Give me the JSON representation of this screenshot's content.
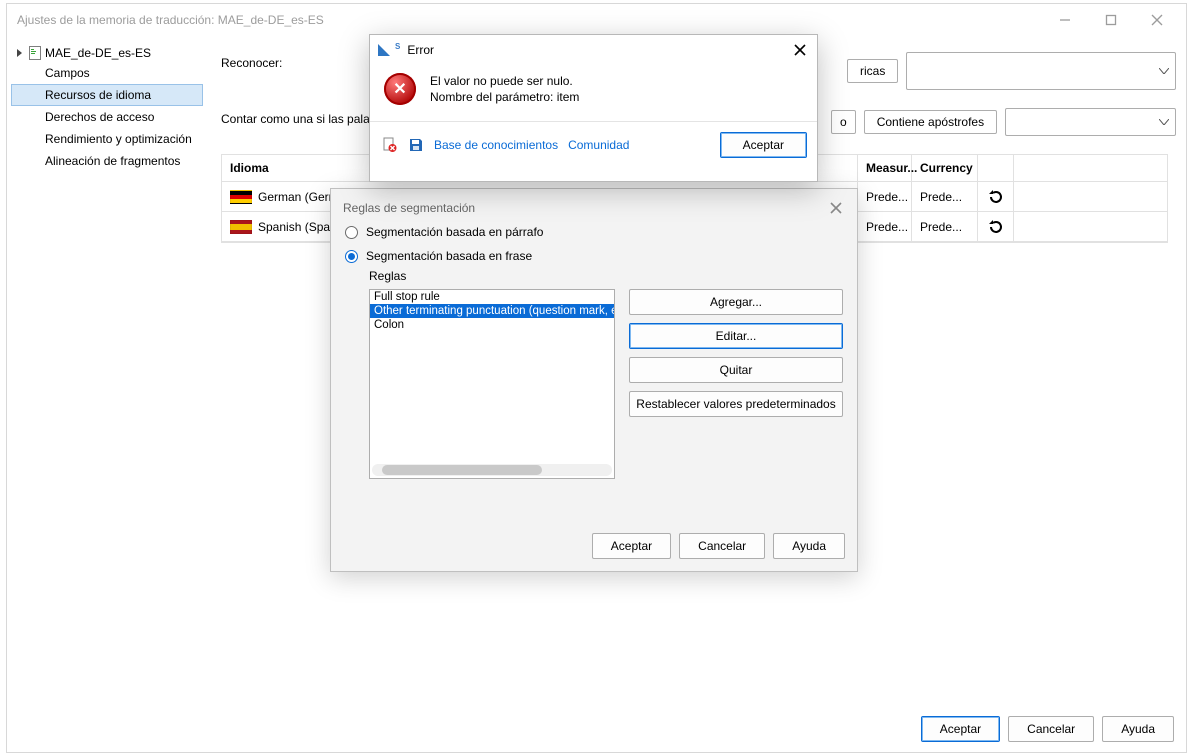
{
  "window": {
    "title": "Ajustes de la memoria de traducción: MAE_de-DE_es-ES"
  },
  "sidebar": {
    "root": "MAE_de-DE_es-ES",
    "items": [
      "Campos",
      "Recursos de idioma",
      "Derechos de acceso",
      "Rendimiento y optimización",
      "Alineación de fragmentos"
    ],
    "selected_index": 1
  },
  "main": {
    "recognize_label": "Reconocer:",
    "recognize_chip_partial": "ricas",
    "count_label": "Contar como una si las palab",
    "count_chip_partial": "o",
    "count_chip2": "Contiene apóstrofes",
    "table": {
      "columns": [
        "Idioma",
        "Measur...",
        "Currency",
        "",
        ""
      ],
      "rows": [
        {
          "flag": "de",
          "lang": "German (Gerr",
          "measur": "Prede...",
          "currency": "Prede..."
        },
        {
          "flag": "es",
          "lang": "Spanish (Spa",
          "measur": "Prede...",
          "currency": "Prede..."
        }
      ]
    }
  },
  "seg_dialog": {
    "title": "Reglas de segmentación",
    "radio_paragraph": "Segmentación basada en párrafo",
    "radio_sentence": "Segmentación basada en frase",
    "rules_label": "Reglas",
    "rules": [
      "Full stop rule",
      "Other terminating punctuation (question mark, e",
      "Colon"
    ],
    "selected_rule_index": 1,
    "buttons": {
      "add": "Agregar...",
      "edit": "Editar...",
      "remove": "Quitar",
      "reset": "Restablecer valores predeterminados"
    },
    "bottom": {
      "accept": "Aceptar",
      "cancel": "Cancelar",
      "help": "Ayuda"
    }
  },
  "error_dialog": {
    "title": "Error",
    "line1": "El valor no puede ser nulo.",
    "line2": "Nombre del parámetro: item",
    "kb": "Base de conocimientos",
    "community": "Comunidad",
    "accept": "Aceptar"
  },
  "bottom_buttons": {
    "accept": "Aceptar",
    "cancel": "Cancelar",
    "help": "Ayuda"
  }
}
